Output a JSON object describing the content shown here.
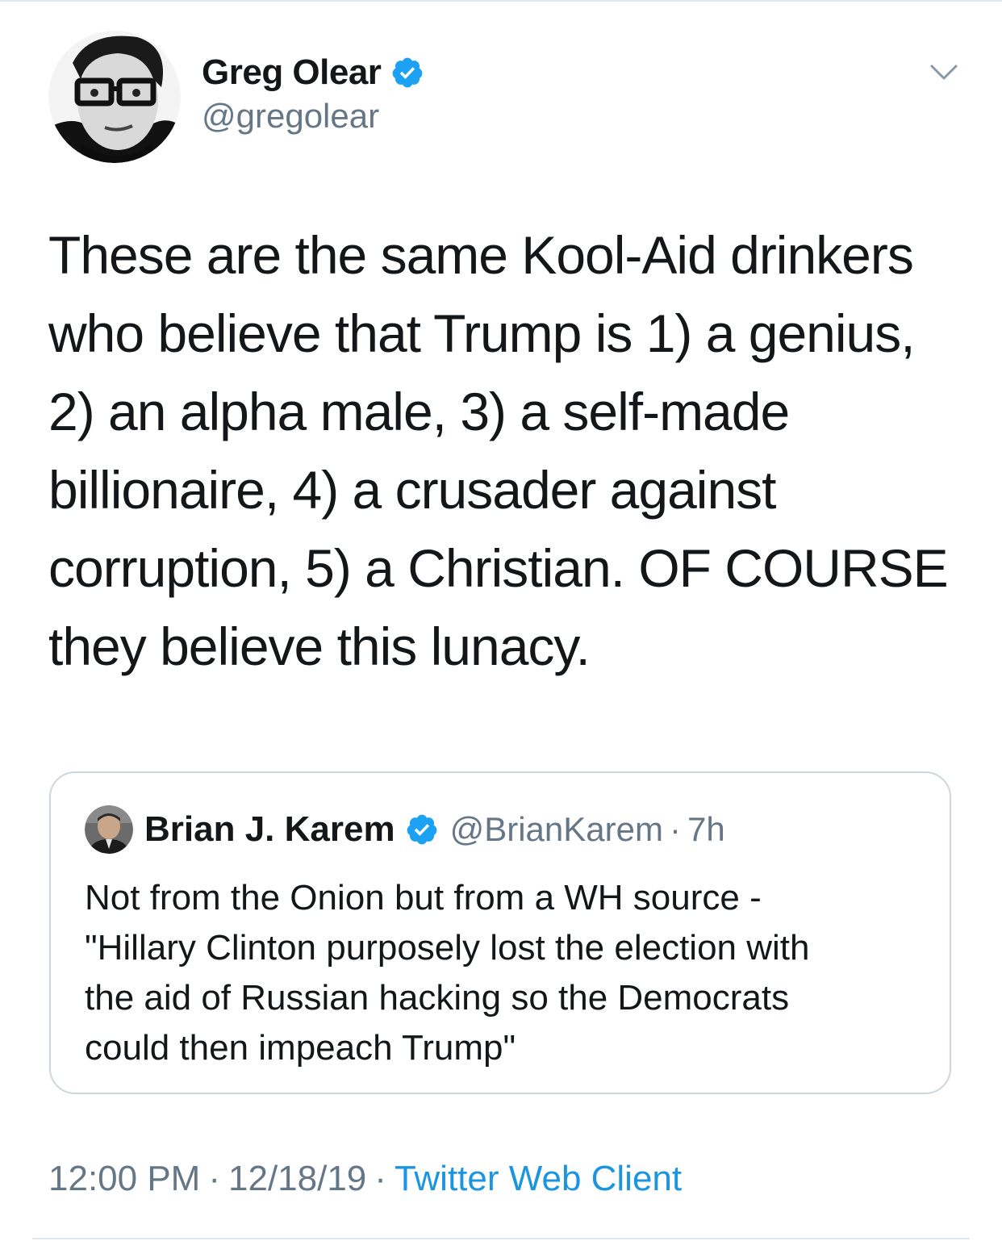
{
  "tweet": {
    "author": {
      "display_name": "Greg Olear",
      "handle": "@gregolear",
      "verified": true,
      "avatar_icon": "avatar-photo"
    },
    "text": "These are the same Kool-Aid drinkers\nwho believe that Trump is 1) a genius,\n2) an alpha male, 3) a self-made\nbillionaire, 4) a crusader against\ncorruption, 5) a Christian. OF COURSE\nthey believe this lunacy.",
    "quoted": {
      "display_name": "Brian J. Karem",
      "handle": "@BrianKarem",
      "separator": "·",
      "time": "7h",
      "verified": true,
      "text": "Not from the Onion but from a WH source -\n\"Hillary Clinton purposely lost the election with\nthe aid of Russian hacking so the Democrats\ncould then impeach Trump\""
    },
    "meta": {
      "time": "12:00 PM",
      "sep1": "·",
      "date": "12/18/19",
      "sep2": "·",
      "source": "Twitter Web Client"
    }
  },
  "colors": {
    "text": "#14171a",
    "secondary": "#657786",
    "link": "#1b95e0",
    "verified": "#1da1f2",
    "border": "#ccd6dd"
  }
}
